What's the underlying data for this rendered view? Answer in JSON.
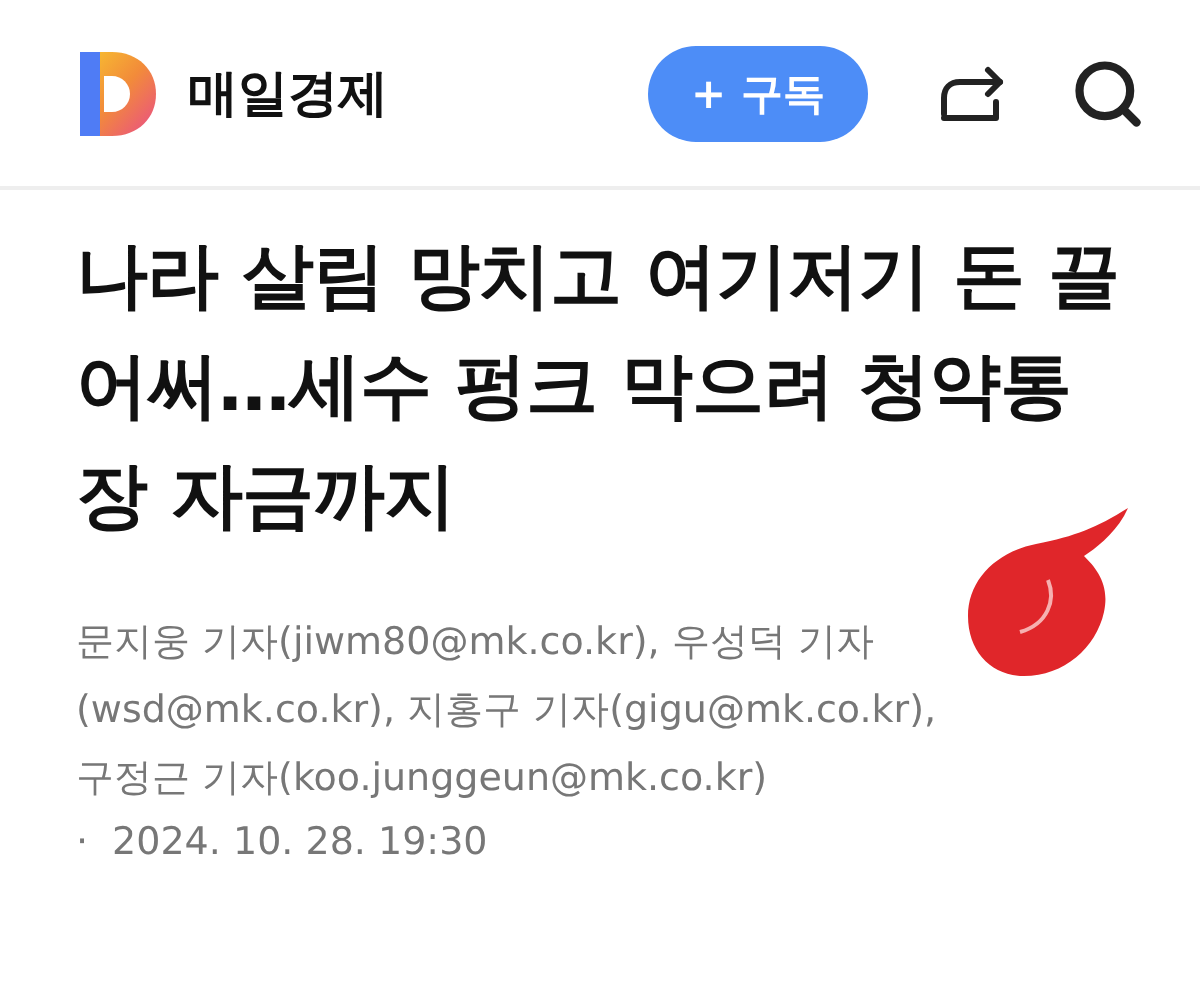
{
  "header": {
    "brand": "매일경제",
    "subscribe_button": "+ 구독"
  },
  "article": {
    "headline": "나라 살림 망치고 여기저기 돈 끌어써…세수 펑크 막으려 청약통장 자금까지",
    "byline": "문지웅 기자(jiwm80@mk.co.kr), 우성덕 기자(wsd@mk.co.kr), 지홍구 기자(gigu@mk.co.kr), 구정근 기자(koo.junggeun@mk.co.kr)",
    "bullet": "·",
    "date": "2024. 10. 28. 19:30"
  }
}
